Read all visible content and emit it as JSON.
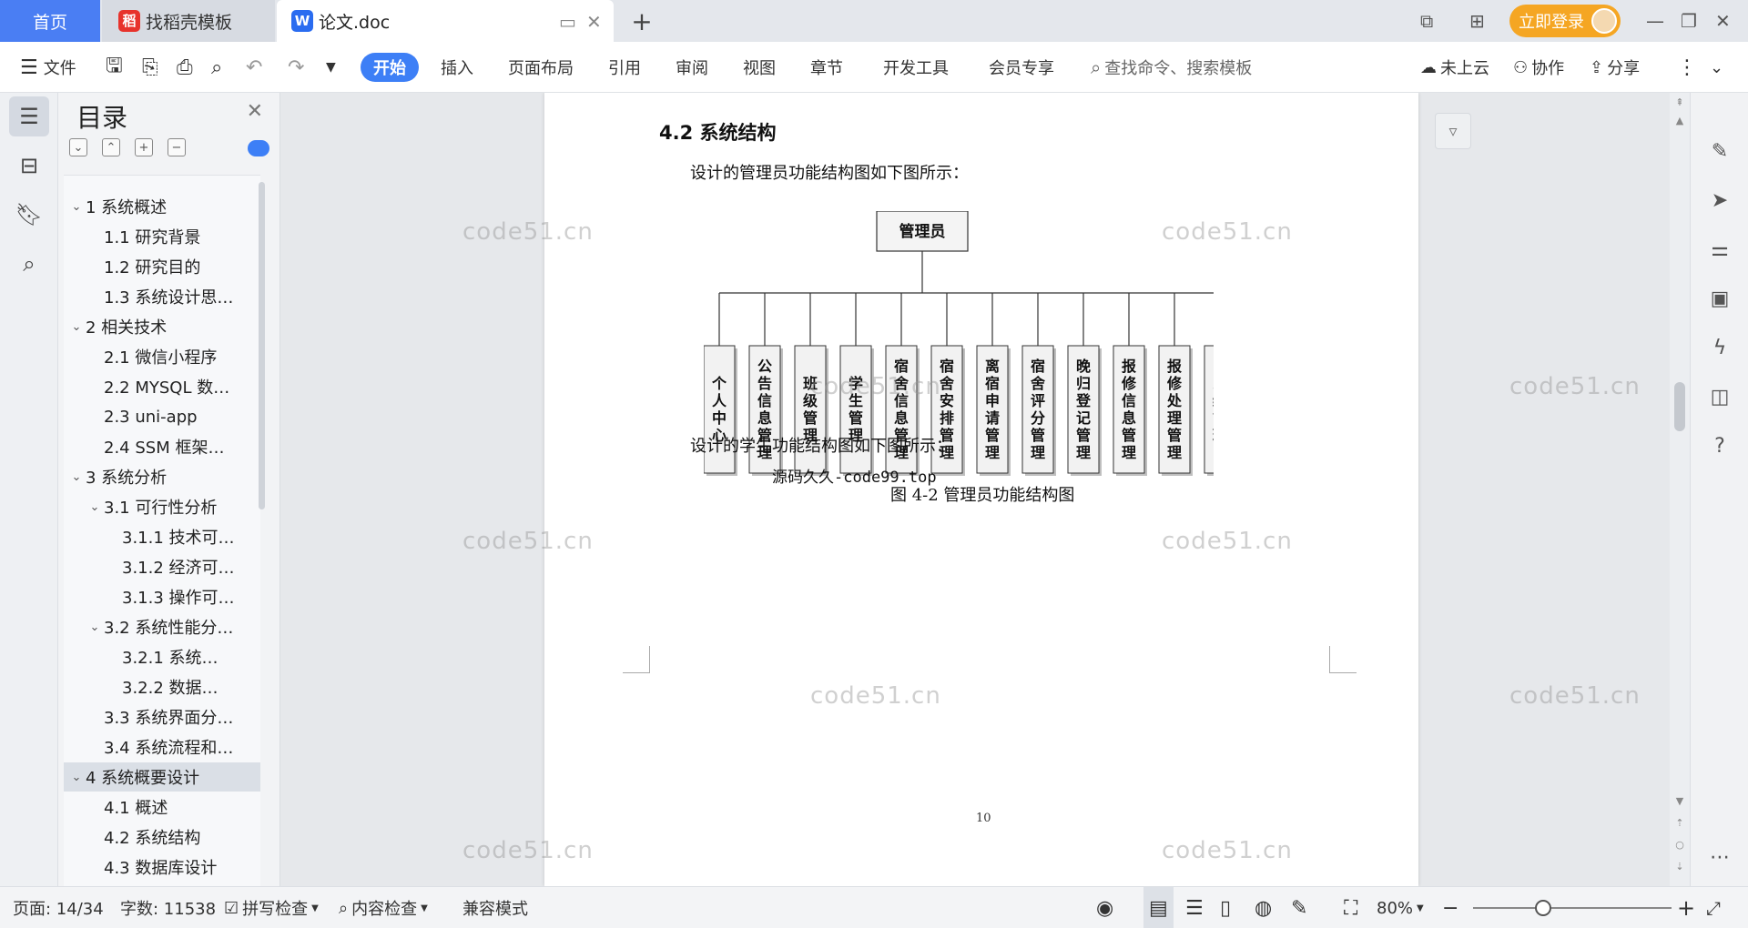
{
  "tabs": {
    "home": "首页",
    "find_template": "找稻壳模板",
    "document": "论文.doc",
    "add": "+"
  },
  "header": {
    "login": "立即登录"
  },
  "toolbar": {
    "file": "文件",
    "ribbon_tabs": [
      "开始",
      "插入",
      "页面布局",
      "引用",
      "审阅",
      "视图",
      "章节",
      "开发工具",
      "会员专享"
    ],
    "search_placeholder": "查找命令、搜索模板",
    "cloud": "未上云",
    "collab": "协作",
    "share": "分享"
  },
  "toc": {
    "title": "目录",
    "items": [
      {
        "label": "1 系统概述",
        "level": 1,
        "expanded": true
      },
      {
        "label": "1.1  研究背景",
        "level": 2
      },
      {
        "label": "1.2 研究目的",
        "level": 2
      },
      {
        "label": "1.3 系统设计思…",
        "level": 2
      },
      {
        "label": "2 相关技术",
        "level": 1,
        "expanded": true
      },
      {
        "label": "2.1 微信小程序",
        "level": 2
      },
      {
        "label": "2.2 MYSQL 数…",
        "level": 2
      },
      {
        "label": "2.3 uni-app",
        "level": 2
      },
      {
        "label": "2.4 SSM 框架…",
        "level": 2
      },
      {
        "label": "3 系统分析",
        "level": 1,
        "expanded": true
      },
      {
        "label": "3.1 可行性分析",
        "level": 2,
        "expanded": true
      },
      {
        "label": "3.1.1 技术可…",
        "level": 3
      },
      {
        "label": "3.1.2 经济可…",
        "level": 3
      },
      {
        "label": "3.1.3 操作可…",
        "level": 3
      },
      {
        "label": "3.2 系统性能分…",
        "level": 2,
        "expanded": true
      },
      {
        "label": "3.2.1  系统…",
        "level": 3
      },
      {
        "label": "3.2.2  数据…",
        "level": 3
      },
      {
        "label": "3.3 系统界面分…",
        "level": 2
      },
      {
        "label": "3.4 系统流程和…",
        "level": 2
      },
      {
        "label": "4 系统概要设计",
        "level": 1,
        "expanded": true,
        "selected": true
      },
      {
        "label": "4.1 概述",
        "level": 2
      },
      {
        "label": "4.2 系统结构",
        "level": 2
      },
      {
        "label": "4.3 数据库设计",
        "level": 2
      }
    ]
  },
  "document": {
    "heading": "4.2 系统结构",
    "intro_admin": "设计的管理员功能结构图如下图所示：",
    "source_note": "源码久久-code99.top",
    "caption": "图 4-2 管理员功能结构图",
    "intro_student": "设计的学生功能结构图如下图所示：",
    "page_number": "10",
    "watermark": "code51.cn"
  },
  "diagram": {
    "root": "管理员",
    "children": [
      "个人中心",
      "公告信息管理",
      "班级管理",
      "学生管理",
      "宿舍信息管理",
      "宿舍安排管理",
      "离宿申请管理",
      "宿舍评分管理",
      "晚归登记管理",
      "报修信息管理",
      "报修处理管理",
      "系统管理"
    ]
  },
  "status": {
    "page": "页面: 14/34",
    "words": "字数: 11538",
    "spell": "拼写检查",
    "content_check": "内容检查",
    "compat": "兼容模式",
    "zoom": "80%"
  },
  "colors": {
    "accent": "#3d7ff6",
    "login": "#f5a623",
    "home_tab": "#4a7ef3"
  }
}
